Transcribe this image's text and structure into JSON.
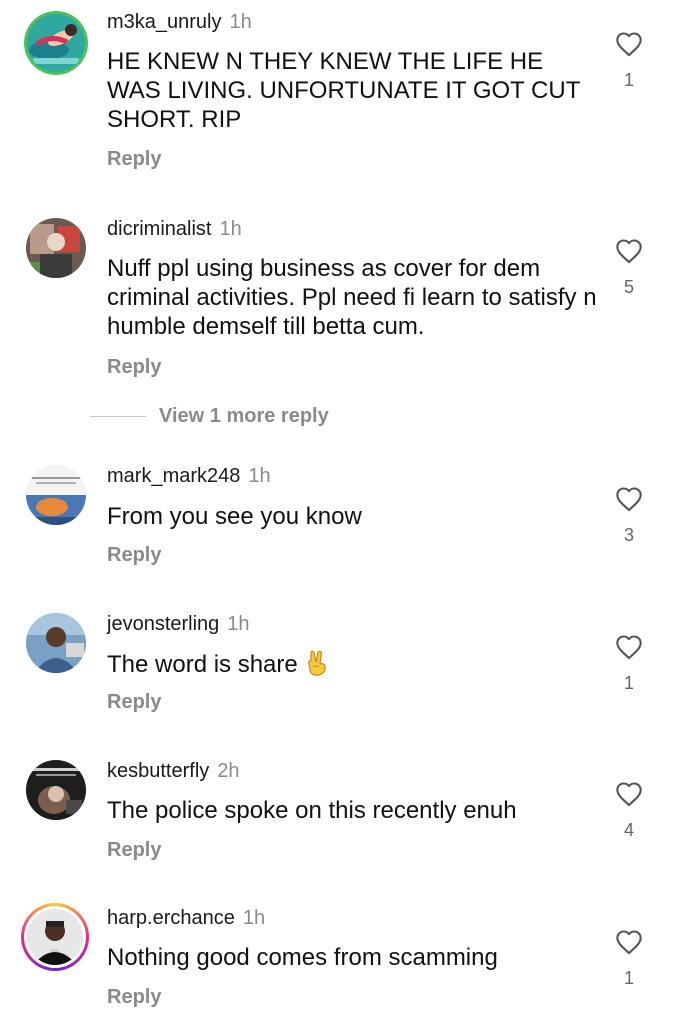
{
  "comments": [
    {
      "username": "m3ka_unruly",
      "time": "1h",
      "text": "HE KNEW N THEY KNEW THE LIFE HE WAS LIVING. UNFORTUNATE IT GOT CUT SHORT. RIP",
      "reply_label": "Reply",
      "likes": "1",
      "avatar_icon": "avatar-image"
    },
    {
      "username": "dicriminalist",
      "time": "1h",
      "text": "Nuff ppl using business as cover for dem criminal activities.  Ppl need fi learn to satisfy n humble demself till betta cum.",
      "reply_label": "Reply",
      "likes": "5",
      "avatar_icon": "avatar-image"
    },
    {
      "username": "mark_mark248",
      "time": "1h",
      "text": "From you see you know",
      "reply_label": "Reply",
      "likes": "3",
      "avatar_icon": "avatar-image"
    },
    {
      "username": "jevonsterling",
      "time": "1h",
      "text": "The word is share",
      "text_emoji": "victory-hand-emoji",
      "reply_label": "Reply",
      "likes": "1",
      "avatar_icon": "avatar-image"
    },
    {
      "username": "kesbutterfly",
      "time": "2h",
      "text": "The police spoke on this recently enuh",
      "reply_label": "Reply",
      "likes": "4",
      "avatar_icon": "avatar-image"
    },
    {
      "username": "harp.erchance",
      "time": "1h",
      "text": "Nothing good comes from scamming",
      "reply_label": "Reply",
      "likes": "1",
      "avatar_icon": "avatar-image-story-ring"
    }
  ],
  "view_more_replies": "View 1 more reply",
  "icons": {
    "like": "heart-outline-icon"
  },
  "colors": {
    "text": "#111111",
    "muted": "#8a8a8a",
    "story_ring": [
      "#f9ce34",
      "#ee2a7b",
      "#6228d7"
    ],
    "green_ring": "#4cc35a"
  }
}
